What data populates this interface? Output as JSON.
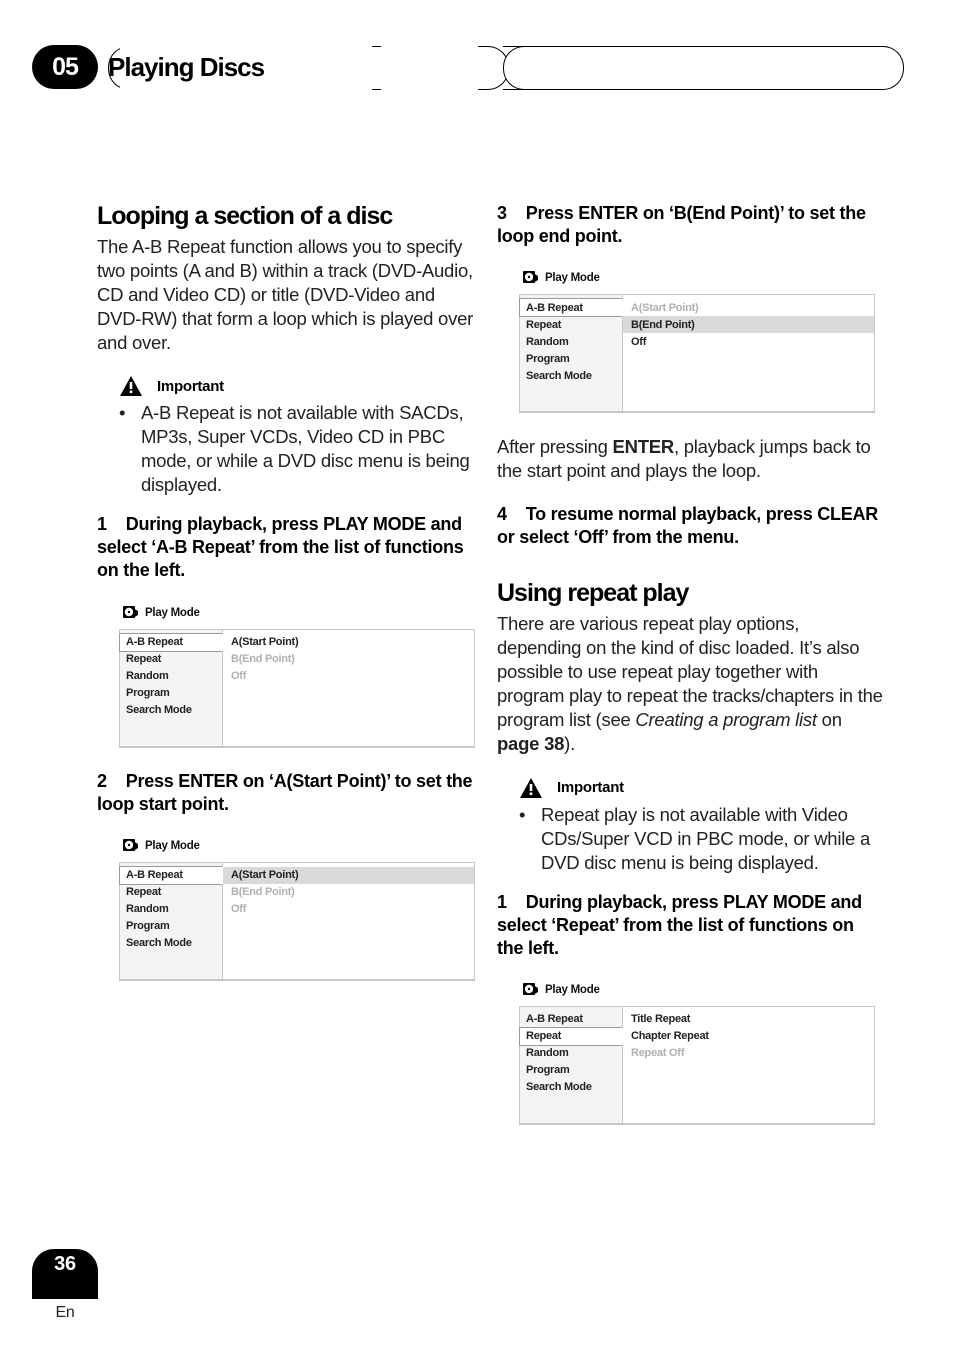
{
  "header": {
    "chapter_number": "05",
    "chapter_title": "Playing Discs"
  },
  "page": {
    "number": "36",
    "lang": "En"
  },
  "left_col": {
    "h1": "Looping a section of a disc",
    "intro": "The A-B Repeat function allows you to specify two points (A and B) within a track (DVD-Audio, CD and Video CD) or title (DVD-Video and DVD-RW) that form a loop which is played over and over.",
    "important_label": "Important",
    "important_bullet": "A-B Repeat is not available with SACDs, MP3s, Super VCDs, Video CD in PBC mode, or while a DVD disc menu is being displayed.",
    "step1": {
      "num": "1",
      "text": "During playback, press PLAY MODE and select ‘A-B Repeat’ from the list of functions on the left."
    },
    "step2": {
      "num": "2",
      "text": "Press ENTER on ‘A(Start Point)’ to set the loop start point."
    }
  },
  "right_col": {
    "step3": {
      "num": "3",
      "text": "Press ENTER on ‘B(End Point)’ to set the loop end point."
    },
    "after_enter_pre": "After pressing ",
    "after_enter_bold": "ENTER",
    "after_enter_post": ", playback jumps back to the start point and plays the loop.",
    "step4": {
      "num": "4",
      "text": "To resume normal playback, press CLEAR or select ‘Off’ from the menu."
    },
    "h1": "Using repeat play",
    "intro_pre": "There are various repeat play options, depending on the kind of disc loaded. It’s also possible to use repeat play together with program play to repeat the tracks/chapters in the program list (see ",
    "intro_ref": "Creating a program list",
    "intro_mid": " on ",
    "intro_page": "page 38",
    "intro_post": ").",
    "important_label": "Important",
    "important_bullet": "Repeat play is not available with Video CDs/Super VCD in PBC mode, or while a DVD disc menu is being displayed.",
    "step1": {
      "num": "1",
      "text": "During playback, press PLAY MODE and select ‘Repeat’ from the list of functions on the left."
    }
  },
  "pm": {
    "title": "Play Mode",
    "left_items": [
      "A-B Repeat",
      "Repeat",
      "Random",
      "Program",
      "Search Mode"
    ],
    "ab_right": {
      "a": "A(Start Point)",
      "b": "B(End Point)",
      "off": "Off"
    },
    "repeat_right": {
      "title": "Title Repeat",
      "chapter": "Chapter Repeat",
      "off": "Repeat Off"
    }
  }
}
